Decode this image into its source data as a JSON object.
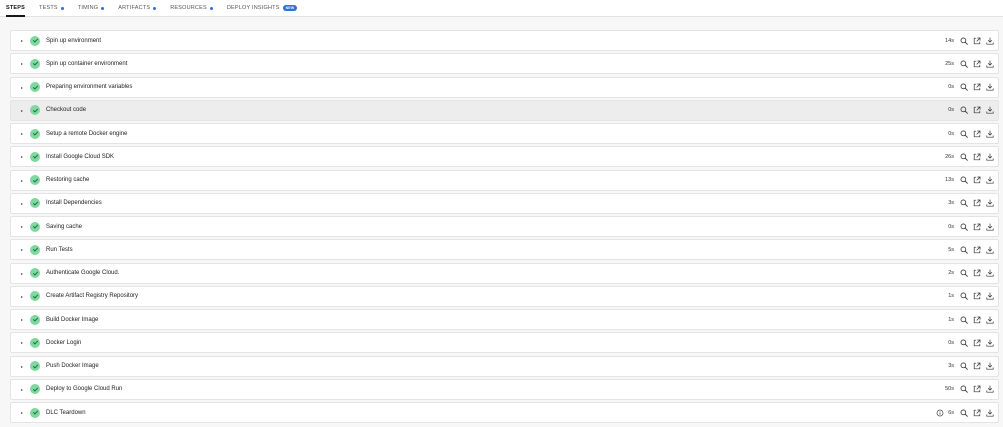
{
  "tabs": [
    {
      "label": "STEPS",
      "active": true
    },
    {
      "label": "TESTS",
      "dot": "#2f6fdb"
    },
    {
      "label": "TIMING",
      "dot": "#2f6fdb"
    },
    {
      "label": "ARTIFACTS",
      "dot": "#2f6fdb"
    },
    {
      "label": "RESOURCES",
      "dot": "#2f6fdb"
    },
    {
      "label": "DEPLOY INSIGHTS",
      "badge": "NEW",
      "badge_color": "#2f6fdb"
    }
  ],
  "colors": {
    "success": "#7ed8a0",
    "check_mark": "#1b6b3a"
  },
  "steps": [
    {
      "name": "Spin up environment",
      "duration": "14s",
      "status": "success"
    },
    {
      "name": "Spin up container environment",
      "duration": "25s",
      "status": "success"
    },
    {
      "name": "Preparing environment variables",
      "duration": "0s",
      "status": "success"
    },
    {
      "name": "Checkout code",
      "duration": "0s",
      "status": "success",
      "hover": true
    },
    {
      "name": "Setup a remote Docker engine",
      "duration": "0s",
      "status": "success"
    },
    {
      "name": "Install Google Cloud SDK",
      "duration": "26s",
      "status": "success"
    },
    {
      "name": "Restoring cache",
      "duration": "13s",
      "status": "success"
    },
    {
      "name": "Install Dependencies",
      "duration": "3s",
      "status": "success"
    },
    {
      "name": "Saving cache",
      "duration": "0s",
      "status": "success"
    },
    {
      "name": "Run Tests",
      "duration": "5s",
      "status": "success"
    },
    {
      "name": "Authenticate Google Cloud.",
      "duration": "2s",
      "status": "success"
    },
    {
      "name": "Create Artifact Registry Repository",
      "duration": "1s",
      "status": "success"
    },
    {
      "name": "Build Docker Image",
      "duration": "1s",
      "status": "success"
    },
    {
      "name": "Docker Login",
      "duration": "0s",
      "status": "success"
    },
    {
      "name": "Push Docker Image",
      "duration": "3s",
      "status": "success"
    },
    {
      "name": "Deploy to Google Cloud Run",
      "duration": "50s",
      "status": "success"
    },
    {
      "name": "DLC Teardown",
      "duration": "6s",
      "status": "success",
      "info_icon": true
    }
  ],
  "icons": {
    "caret": "caret-right-icon",
    "status": "check-circle-icon",
    "search": "search-icon",
    "open": "open-external-icon",
    "download": "download-icon",
    "info": "info-icon"
  }
}
